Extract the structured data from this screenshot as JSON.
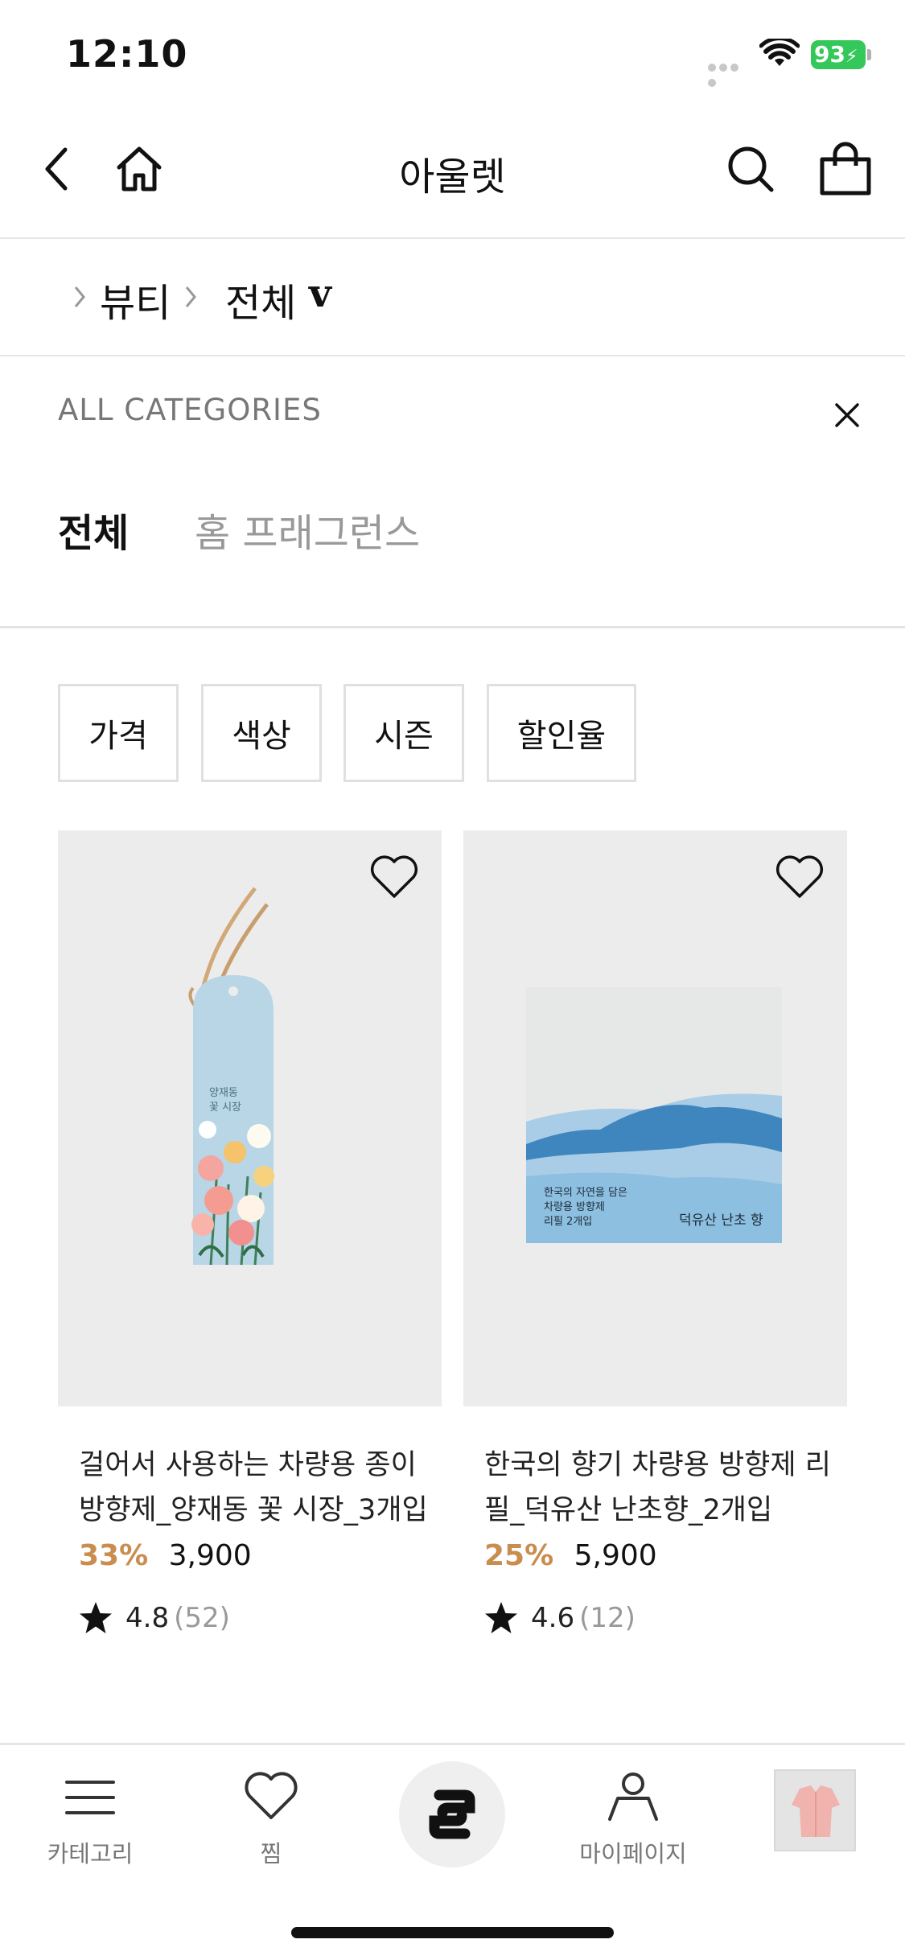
{
  "status_bar": {
    "time": "12:10",
    "battery_level": "93",
    "battery_color": "#34c759",
    "icons": [
      "signal-dots-icon",
      "wifi-icon",
      "battery-icon"
    ]
  },
  "header": {
    "title": "아울렛",
    "icons": [
      "back-icon",
      "home-icon",
      "search-icon",
      "shopping-bag-icon"
    ]
  },
  "breadcrumb": {
    "items": [
      "뷰티",
      "전체"
    ],
    "dropdown_glyph": "v"
  },
  "categories": {
    "heading": "ALL CATEGORIES",
    "tabs": [
      {
        "label": "전체",
        "active": true
      },
      {
        "label": "홈 프래그런스",
        "active": false
      }
    ]
  },
  "filters": [
    "가격",
    "색상",
    "시즌",
    "할인율"
  ],
  "products": [
    {
      "name_line1": "걸어서 사용하는 차량용 종이",
      "name_line2": "방향제_양재동 꽃 시장_3개입",
      "discount": "33%",
      "price": "3,900",
      "rating": "4.8",
      "review_count": "(52)",
      "image_caption_lines": [
        "양재동",
        "꽃 시장"
      ]
    },
    {
      "name_line1": "한국의 향기 차량용 방향제 리",
      "name_line2": "필_덕유산 난초향_2개입",
      "discount": "25%",
      "price": "5,900",
      "rating": "4.6",
      "review_count": "(12)",
      "image_caption_lines": [
        "한국의 자연을 담은",
        "차량용 방향제",
        "리필 2개입"
      ],
      "image_caption_right": "덕유산 난초 향"
    }
  ],
  "accent_colors": {
    "discount": "#c98d4f",
    "star": "#111111"
  },
  "tabbar": {
    "items": [
      {
        "label": "카테고리",
        "icon": "menu-icon"
      },
      {
        "label": "찜",
        "icon": "heart-icon"
      },
      {
        "label": "",
        "icon": "brand-logo-icon"
      },
      {
        "label": "마이페이지",
        "icon": "user-icon"
      },
      {
        "label": "",
        "icon": "recent-item-thumbnail"
      }
    ]
  }
}
